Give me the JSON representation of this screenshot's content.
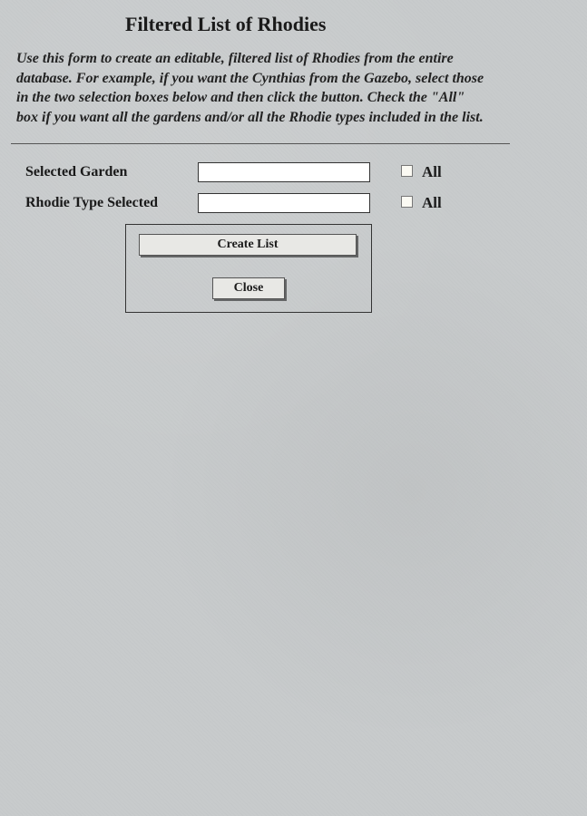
{
  "header": {
    "title": "Filtered List of Rhodies"
  },
  "instructions": "Use this form to create an editable, filtered list of Rhodies from the entire database.  For example, if you want the Cynthias from the Gazebo, select those in the two selection boxes below and then click the button.  Check the \"All\" box if you want all the gardens and/or all the Rhodie types included in the list.",
  "fields": {
    "garden": {
      "label": "Selected Garden",
      "value": "",
      "all_label": "All"
    },
    "rhodie_type": {
      "label": "Rhodie Type Selected",
      "value": "",
      "all_label": "All"
    }
  },
  "buttons": {
    "create": "Create List",
    "close": "Close"
  }
}
